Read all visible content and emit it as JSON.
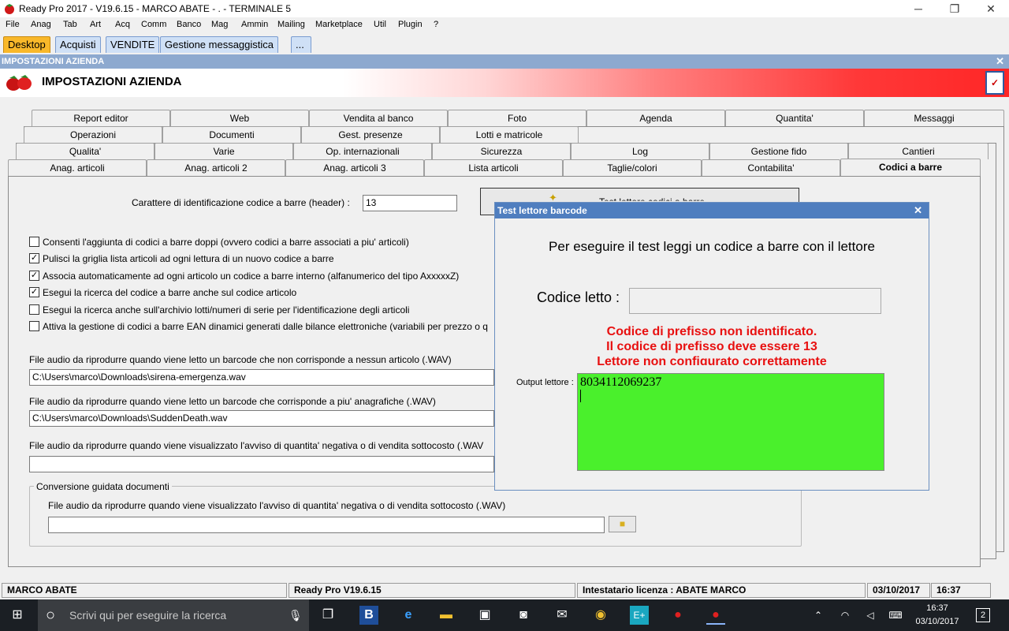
{
  "window": {
    "title": "Ready Pro 2017 - V19.6.15 - MARCO ABATE - . - TERMINALE 5",
    "minimize": "─",
    "maximize": "❐",
    "close": "✕"
  },
  "menu": [
    "File",
    "Anag",
    "Tab",
    "Art",
    "Acq",
    "Comm",
    "Banco",
    "Mag",
    "Ammin",
    "Mailing",
    "Marketplace",
    "Util",
    "Plugin",
    "?"
  ],
  "top_tabs": [
    "Desktop",
    "Acquisti",
    "VENDITE",
    "Gestione messaggistica",
    "..."
  ],
  "section": {
    "header": "IMPOSTAZIONI AZIENDA",
    "title": "IMPOSTAZIONI AZIENDA",
    "close": "✕"
  },
  "tabs_row1": [
    "Report editor",
    "Web",
    "Vendita al banco",
    "Foto",
    "Agenda",
    "Quantita'",
    "Messaggi"
  ],
  "tabs_row2": [
    "Operazioni",
    "Documenti",
    "Gest. presenze",
    "Lotti e matricole"
  ],
  "tabs_row3": [
    "Qualita'",
    "Varie",
    "Op. internazionali",
    "Sicurezza",
    "Log",
    "Gestione fido",
    "Cantieri"
  ],
  "tabs_row4": [
    "Anag. articoli",
    "Anag. articoli 2",
    "Anag. articoli 3",
    "Lista articoli",
    "Taglie/colori",
    "Contabilita'",
    "Codici a barre"
  ],
  "panel": {
    "header_label": "Carattere di identificazione codice a barre (header) :",
    "header_value": "13",
    "test_button": "Test lettore codici a barre",
    "checkboxes": [
      {
        "label": "Consenti l'aggiunta di codici a barre doppi (ovvero codici a barre associati a piu' articoli)",
        "checked": false
      },
      {
        "label": "Pulisci la griglia lista articoli ad ogni lettura di un nuovo codice a barre",
        "checked": true
      },
      {
        "label": "Associa automaticamente ad ogni articolo un codice a barre interno (alfanumerico del tipo AxxxxxZ)",
        "checked": true
      },
      {
        "label": "Esegui la ricerca del codice a barre anche sul codice articolo",
        "checked": true
      },
      {
        "label": "Esegui la ricerca anche sull'archivio lotti/numeri di serie per l'identificazione degli articoli",
        "checked": false
      },
      {
        "label": "Attiva la gestione di codici a barre EAN dinamici generati dalle bilance elettroniche (variabili per prezzo o q",
        "checked": false
      }
    ],
    "audio1_label": "File audio da riprodurre quando viene letto un barcode che non corrisponde a nessun articolo (.WAV)",
    "audio1_value": "C:\\Users\\marco\\Downloads\\sirena-emergenza.wav",
    "audio2_label": "File audio da riprodurre quando viene letto un barcode che corrisponde a piu' anagrafiche (.WAV)",
    "audio2_value": "C:\\Users\\marco\\Downloads\\SuddenDeath.wav",
    "audio3_label": "File audio da riprodurre quando viene visualizzato l'avviso di quantita' negativa o di vendita sottocosto (.WAV",
    "audio3_value": "",
    "group_title": "Conversione guidata documenti",
    "group_audio_label": "File audio da riprodurre quando viene visualizzato l'avviso di quantita' negativa o di vendita sottocosto (.WAV)",
    "group_audio_value": ""
  },
  "dialog": {
    "title": "Test lettore barcode",
    "close": "✕",
    "message": "Per eseguire il test leggi un codice a barre con il lettore",
    "codice_label": "Codice letto :",
    "codice_value": "",
    "error_lines": [
      "Codice di prefisso non identificato.",
      "Il codice di prefisso deve essere 13",
      "Lettore non configurato correttamente"
    ],
    "output_label": "Output lettore :",
    "output_value": "8034112069237"
  },
  "status": {
    "user": "MARCO ABATE",
    "version": "Ready Pro V19.6.15",
    "license": "Intestatario licenza : ABATE MARCO",
    "date": "03/10/2017",
    "time": "16:37"
  },
  "taskbar": {
    "search_placeholder": "Scrivi qui per eseguire la ricerca",
    "time": "16:37",
    "date": "03/10/2017",
    "notifications": "2"
  }
}
